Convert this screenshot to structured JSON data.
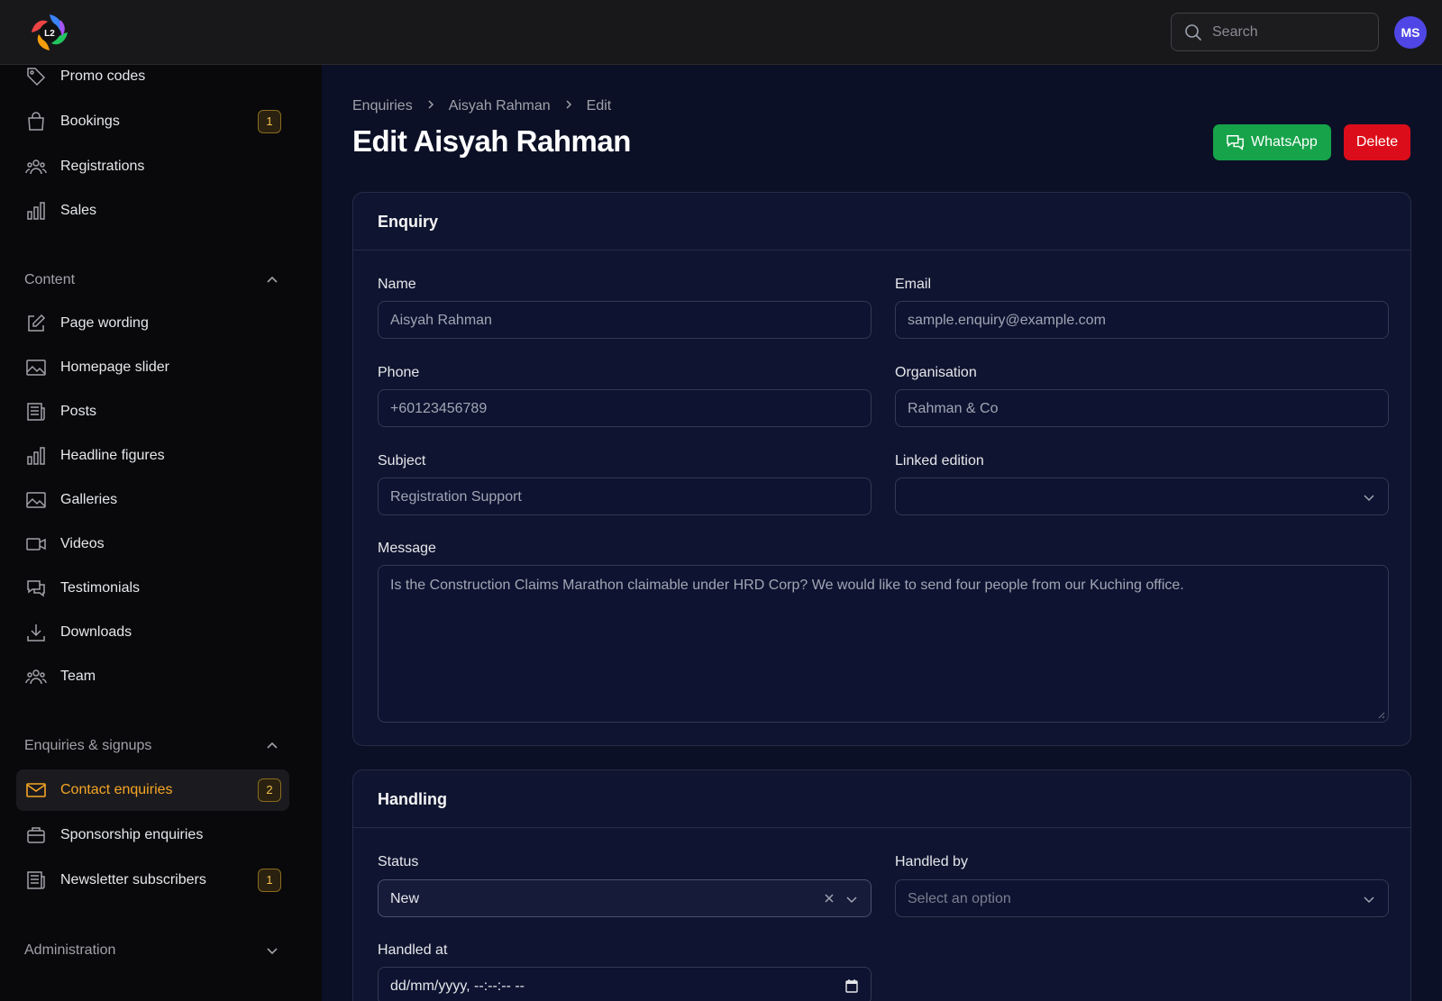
{
  "header": {
    "logo_text": "L2",
    "search_placeholder": "Search",
    "avatar_initials": "MS"
  },
  "sidebar": {
    "items_top": [
      {
        "label": "Promo codes",
        "icon": "tag-icon"
      },
      {
        "label": "Bookings",
        "icon": "shopping-bag-icon",
        "badge": "1"
      },
      {
        "label": "Registrations",
        "icon": "users-icon"
      },
      {
        "label": "Sales",
        "icon": "bar-chart-icon"
      }
    ],
    "group_content": "Content",
    "items_content": [
      {
        "label": "Page wording",
        "icon": "pencil-square-icon"
      },
      {
        "label": "Homepage slider",
        "icon": "image-icon"
      },
      {
        "label": "Posts",
        "icon": "newspaper-icon"
      },
      {
        "label": "Headline figures",
        "icon": "bar-chart-icon"
      },
      {
        "label": "Galleries",
        "icon": "image-icon"
      },
      {
        "label": "Videos",
        "icon": "video-camera-icon"
      },
      {
        "label": "Testimonials",
        "icon": "chat-bubbles-icon"
      },
      {
        "label": "Downloads",
        "icon": "download-icon"
      },
      {
        "label": "Team",
        "icon": "user-group-icon"
      }
    ],
    "group_enquiries": "Enquiries & signups",
    "items_enquiries": [
      {
        "label": "Contact enquiries",
        "icon": "envelope-icon",
        "badge": "2",
        "active": true
      },
      {
        "label": "Sponsorship enquiries",
        "icon": "briefcase-icon"
      },
      {
        "label": "Newsletter subscribers",
        "icon": "newspaper-icon",
        "badge": "1"
      }
    ],
    "group_admin": "Administration"
  },
  "breadcrumb": [
    "Enquiries",
    "Aisyah Rahman",
    "Edit"
  ],
  "page_title": "Edit Aisyah Rahman",
  "actions": {
    "whatsapp": "WhatsApp",
    "delete": "Delete"
  },
  "colors": {
    "accent": "#f5a524",
    "whatsapp": "#16a34a",
    "delete": "#dc0d1a",
    "avatar": "#4f46e5"
  },
  "enquiry": {
    "heading": "Enquiry",
    "name_label": "Name",
    "name_value": "Aisyah Rahman",
    "email_label": "Email",
    "email_value": "sample.enquiry@example.com",
    "phone_label": "Phone",
    "phone_value": "+60123456789",
    "org_label": "Organisation",
    "org_value": "Rahman & Co",
    "subject_label": "Subject",
    "subject_value": "Registration Support",
    "edition_label": "Linked edition",
    "edition_value": "",
    "message_label": "Message",
    "message_value": "Is the Construction Claims Marathon claimable under HRD Corp? We would like to send four people from our Kuching office."
  },
  "handling": {
    "heading": "Handling",
    "status_label": "Status",
    "status_value": "New",
    "handled_by_label": "Handled by",
    "handled_by_placeholder": "Select an option",
    "handled_at_label": "Handled at",
    "handled_at_value": "dd/mm/yyyy, --:--:-- --"
  }
}
